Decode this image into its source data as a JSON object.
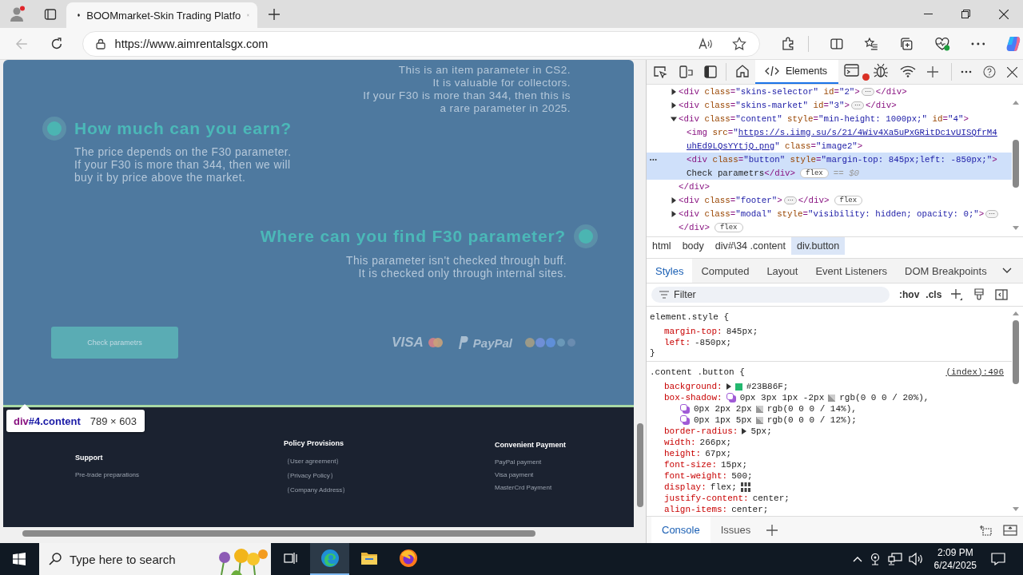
{
  "browser": {
    "tab_title": "BOOMmarket-Skin Trading Platfo",
    "url": "https://www.aimrentalsgx.com",
    "back_disabled": true
  },
  "page": {
    "intro": [
      "This is an item parameter in CS2.",
      "It is valuable for collectors.",
      "If your F30 is more than 344, then this is",
      "a rare parameter in 2025."
    ],
    "sections": [
      {
        "kind": "left",
        "title": "How much can you earn?",
        "lines": [
          "The price depends on the F30 parameter.",
          "If your F30 is more than 344, then we will",
          "buy it by price above the market."
        ]
      },
      {
        "kind": "right",
        "title": "Where can you find F30 parameter?",
        "lines": [
          "This parameter isn't checked through buff.",
          "It is checked only through internal sites."
        ]
      }
    ],
    "button": "Check parametrs",
    "visa": "VISA",
    "paypal": "PayPal",
    "footer": [
      {
        "heading": "Support",
        "links": [
          "Pre-trade preparations"
        ]
      },
      {
        "heading": "Policy Provisions",
        "links": [
          "｛User agreement｝",
          "｛Privacy Policy｝",
          "｛Company Address｝"
        ]
      },
      {
        "heading": "Convenient Payment",
        "links": [
          "PayPal payment",
          "Visa payment",
          "MasterCrd Payment"
        ]
      }
    ],
    "inspect_tooltip": {
      "tag": "div",
      "selector": "#4.content",
      "size": "789 × 603"
    }
  },
  "devtools": {
    "tools": [
      {
        "selected": false
      },
      {
        "label": "Elements",
        "selected": true
      },
      {
        "selected": false,
        "alert": true
      },
      {
        "selected": false
      },
      {
        "selected": false
      }
    ],
    "dom": [
      {
        "expanded": false,
        "selected": false,
        "lines": [
          [
            {
              "kind": "code",
              "tokens": [
                {
                  "kind": "tag",
                  "text": "<div "
                },
                {
                  "kind": "attr",
                  "text": "class"
                },
                {
                  "kind": "tag",
                  "text": "="
                },
                {
                  "kind": "value",
                  "text": "\"skins-selector\""
                },
                {
                  "kind": "attr",
                  "text": " id"
                },
                {
                  "kind": "tag",
                  "text": "="
                },
                {
                  "kind": "value",
                  "text": "\"2\""
                },
                {
                  "kind": "tag",
                  "text": ">"
                }
              ]
            },
            {
              "kind": "ellipsis",
              "text": "⋯"
            },
            {
              "kind": "code",
              "tokens": [
                {
                  "kind": "tag",
                  "text": "</div>"
                }
              ]
            }
          ]
        ]
      },
      {
        "expanded": false,
        "selected": false,
        "lines": [
          [
            {
              "kind": "code",
              "tokens": [
                {
                  "kind": "tag",
                  "text": "<div "
                },
                {
                  "kind": "attr",
                  "text": "class"
                },
                {
                  "kind": "tag",
                  "text": "="
                },
                {
                  "kind": "value",
                  "text": "\"skins-market\""
                },
                {
                  "kind": "attr",
                  "text": " id"
                },
                {
                  "kind": "tag",
                  "text": "="
                },
                {
                  "kind": "value",
                  "text": "\"3\""
                },
                {
                  "kind": "tag",
                  "text": ">"
                }
              ]
            },
            {
              "kind": "ellipsis",
              "text": "⋯"
            },
            {
              "kind": "code",
              "tokens": [
                {
                  "kind": "tag",
                  "text": "</div>"
                }
              ]
            }
          ]
        ]
      },
      {
        "expanded": true,
        "selected": false,
        "lines": [
          [
            {
              "kind": "code",
              "tokens": [
                {
                  "kind": "tag",
                  "text": "<div "
                },
                {
                  "kind": "attr",
                  "text": "class"
                },
                {
                  "kind": "tag",
                  "text": "="
                },
                {
                  "kind": "value",
                  "text": "\"content\""
                },
                {
                  "kind": "attr",
                  "text": " style"
                },
                {
                  "kind": "tag",
                  "text": "="
                },
                {
                  "kind": "value",
                  "text": "\"min-height: 1000px;\""
                },
                {
                  "kind": "attr",
                  "text": " id"
                },
                {
                  "kind": "tag",
                  "text": "="
                },
                {
                  "kind": "value",
                  "text": "\"4\""
                },
                {
                  "kind": "tag",
                  "text": ">"
                }
              ]
            }
          ]
        ],
        "children": [
          {
            "selected": false,
            "lines": [
              [
                {
                  "kind": "code",
                  "tokens": [
                    {
                      "kind": "tag",
                      "text": "<img "
                    },
                    {
                      "kind": "attr",
                      "text": "src"
                    },
                    {
                      "kind": "tag",
                      "text": "="
                    },
                    {
                      "kind": "value",
                      "text": "\""
                    }
                  ]
                },
                {
                  "kind": "link",
                  "text": "https://s.iimg.su/s/21/4Wiv4Xa5uPxGRitDc1vUISQfrM4"
                }
              ],
              [
                {
                  "kind": "link",
                  "text": "uhEd9LQsYYtjQ.png"
                },
                {
                  "kind": "code",
                  "tokens": [
                    {
                      "kind": "value",
                      "text": "\""
                    },
                    {
                      "kind": "attr",
                      "text": " class"
                    },
                    {
                      "kind": "tag",
                      "text": "="
                    },
                    {
                      "kind": "value",
                      "text": "\"image2\""
                    },
                    {
                      "kind": "tag",
                      "text": ">"
                    }
                  ]
                }
              ]
            ]
          },
          {
            "selected": true,
            "marker": "•••",
            "lines": [
              [
                {
                  "kind": "code",
                  "tokens": [
                    {
                      "kind": "tag",
                      "text": "<div "
                    },
                    {
                      "kind": "attr",
                      "text": "class"
                    },
                    {
                      "kind": "tag",
                      "text": "="
                    },
                    {
                      "kind": "value",
                      "text": "\"button\""
                    },
                    {
                      "kind": "attr",
                      "text": " style"
                    },
                    {
                      "kind": "tag",
                      "text": "="
                    },
                    {
                      "kind": "value",
                      "text": "\"margin-top: 845px;left: -850px;\""
                    },
                    {
                      "kind": "tag",
                      "text": ">"
                    }
                  ]
                }
              ],
              [
                {
                  "kind": "code",
                  "tokens": [
                    {
                      "kind": "text",
                      "text": "Check parametrs"
                    },
                    {
                      "kind": "tag",
                      "text": "</div>"
                    }
                  ]
                },
                {
                  "kind": "badge",
                  "text": "flex"
                },
                {
                  "kind": "ref",
                  "text": "== $0"
                }
              ]
            ]
          }
        ],
        "closing": [
          [
            {
              "kind": "code",
              "tokens": [
                {
                  "kind": "tag",
                  "text": "</div>"
                }
              ]
            }
          ]
        ]
      },
      {
        "expanded": false,
        "selected": false,
        "lines": [
          [
            {
              "kind": "code",
              "tokens": [
                {
                  "kind": "tag",
                  "text": "<div "
                },
                {
                  "kind": "attr",
                  "text": "class"
                },
                {
                  "kind": "tag",
                  "text": "="
                },
                {
                  "kind": "value",
                  "text": "\"footer\""
                },
                {
                  "kind": "tag",
                  "text": ">"
                }
              ]
            },
            {
              "kind": "ellipsis",
              "text": "⋯"
            },
            {
              "kind": "code",
              "tokens": [
                {
                  "kind": "tag",
                  "text": "</div>"
                }
              ]
            },
            {
              "kind": "badge",
              "text": "flex"
            }
          ]
        ]
      },
      {
        "expanded": false,
        "selected": false,
        "lines": [
          [
            {
              "kind": "code",
              "tokens": [
                {
                  "kind": "tag",
                  "text": "<div "
                },
                {
                  "kind": "attr",
                  "text": "class"
                },
                {
                  "kind": "tag",
                  "text": "="
                },
                {
                  "kind": "value",
                  "text": "\"modal\""
                },
                {
                  "kind": "attr",
                  "text": " style"
                },
                {
                  "kind": "tag",
                  "text": "="
                },
                {
                  "kind": "value",
                  "text": "\"visibility: hidden; opacity: 0;\""
                },
                {
                  "kind": "tag",
                  "text": ">"
                }
              ]
            },
            {
              "kind": "ellipsis",
              "text": "⋯"
            }
          ],
          [
            {
              "kind": "code",
              "tokens": [
                {
                  "kind": "tag",
                  "text": "</div>"
                }
              ]
            },
            {
              "kind": "badge",
              "text": "flex"
            }
          ]
        ]
      }
    ],
    "breadcrumbs": [
      {
        "label": "html",
        "selected": false
      },
      {
        "label": "body",
        "selected": false
      },
      {
        "label": "div#\\34 .content",
        "selected": false
      },
      {
        "label": "div.button",
        "selected": true
      }
    ],
    "style_tabs": [
      {
        "label": "Styles",
        "selected": true
      },
      {
        "label": "Computed",
        "selected": false
      },
      {
        "label": "Layout",
        "selected": false
      },
      {
        "label": "Event Listeners",
        "selected": false
      },
      {
        "label": "DOM Breakpoints",
        "selected": false
      }
    ],
    "filter": {
      "placeholder": "Filter"
    },
    "style_actions": [
      ":hov",
      ".cls"
    ],
    "rules": [
      {
        "selector": "element.style {",
        "decls": [
          {
            "kind": "plain",
            "prop": "margin-top:",
            "value": "845px;"
          },
          {
            "kind": "plain",
            "prop": "left:",
            "value": "-850px;"
          }
        ],
        "close": "}"
      },
      {
        "selector": ".content .button {",
        "source": "(index):496",
        "decls": [
          {
            "kind": "color",
            "prop": "background:",
            "color": "#23b86f",
            "value": "#23B86F;"
          },
          {
            "kind": "shadow",
            "prop": "box-shadow:",
            "value": "0px 3px 1px -2px",
            "rgb": "rgb(0 0 0 / 20%),"
          },
          {
            "kind": "shadow",
            "value": "0px 2px 2px",
            "rgb": "rgb(0 0 0 / 14%),"
          },
          {
            "kind": "shadow",
            "value": "0px 1px 5px",
            "rgb": "rgb(0 0 0 / 12%);"
          },
          {
            "kind": "expand",
            "prop": "border-radius:",
            "value": "5px;"
          },
          {
            "kind": "plain",
            "prop": "width:",
            "value": "266px;"
          },
          {
            "kind": "plain",
            "prop": "height:",
            "value": "67px;"
          },
          {
            "kind": "plain",
            "prop": "font-size:",
            "value": "15px;"
          },
          {
            "kind": "plain",
            "prop": "font-weight:",
            "value": "500;"
          },
          {
            "kind": "flex",
            "prop": "display:",
            "value": "flex;"
          },
          {
            "kind": "plain",
            "prop": "justify-content:",
            "value": "center;"
          },
          {
            "kind": "plain",
            "prop": "align-items:",
            "value": "center;"
          }
        ]
      }
    ],
    "drawer_tabs": [
      {
        "label": "Console",
        "selected": true
      },
      {
        "label": "Issues",
        "selected": false
      }
    ]
  },
  "taskbar": {
    "search_placeholder": "Type here to search",
    "apps": [
      {
        "active": false
      },
      {
        "active": true
      },
      {
        "active": false
      },
      {
        "active": false
      }
    ],
    "time": "2:09 PM",
    "date": "6/24/2025"
  }
}
